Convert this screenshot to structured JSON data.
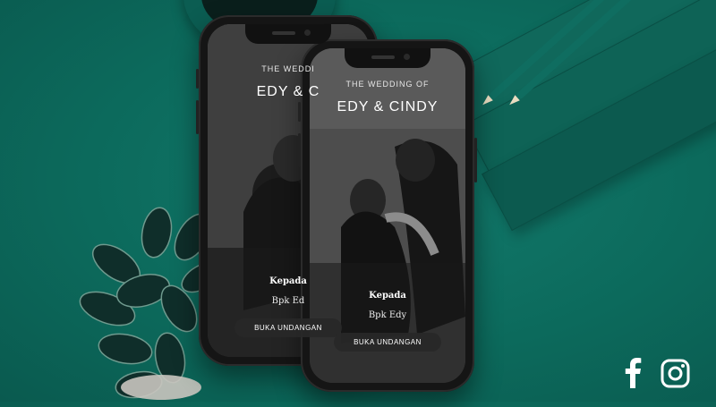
{
  "colors": {
    "background": "#0c6a5c",
    "phone_frame": "#151515",
    "button_bg": "#282828",
    "text": "#ffffff"
  },
  "invitation": {
    "pretitle": "THE WEDDING OF",
    "couple": "EDY & CINDY",
    "to_label": "Kepada",
    "guest_name": "Bpk Edy",
    "open_button": "BUKA UNDANGAN"
  },
  "back_phone": {
    "pretitle": "THE WEDDI",
    "couple": "EDY & C",
    "to_label": "Kepada",
    "guest_name": "Bpk Ed",
    "open_button": "BUKA UNDANGAN"
  },
  "social": {
    "facebook_icon": "facebook-icon",
    "instagram_icon": "instagram-icon"
  }
}
